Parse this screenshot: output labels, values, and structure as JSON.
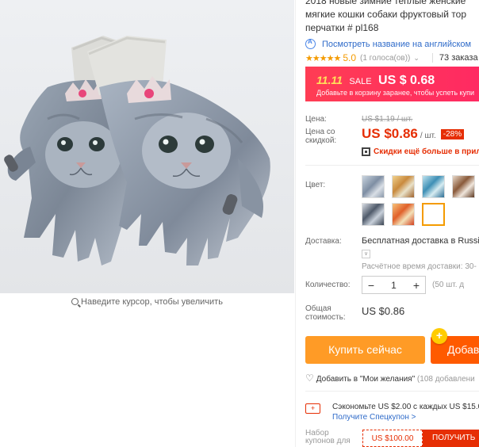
{
  "product": {
    "title_lines": [
      "2018 новые зимние теплые женские",
      "мягкие кошки собаки фруктовый тор",
      "перчатки # pl168"
    ],
    "translate_link": "Посмотреть название на английском",
    "rating_stars": "★★★★★",
    "rating_value": "5.0",
    "votes": "(1 голоса(ов))",
    "orders": "73 заказа"
  },
  "image": {
    "zoom_hint": "Наведите курсор, чтобы увеличить"
  },
  "sale_banner": {
    "date": "11.11",
    "sale": "SALE",
    "amount": "US $ 0.68",
    "note": "Добавьте в корзину заранее, чтобы успеть купи"
  },
  "price": {
    "label": "Цена:",
    "old": "US $1.19 / шт.",
    "discount_label": "Цена со скидкой:",
    "new": "US $0.86",
    "per_unit": "/ шт.",
    "discount_badge": "-28%",
    "promo": "Скидки ещё больше в прило"
  },
  "color": {
    "label": "Цвет:",
    "selected_index": 6
  },
  "shipping": {
    "label": "Доставка:",
    "value": "Бесплатная доставка в Russia",
    "chevron": "∨",
    "time": "Расчётное время доставки: 30-"
  },
  "quantity": {
    "label": "Количество:",
    "minus": "−",
    "value": "1",
    "plus": "+",
    "available": "(50 шт. д"
  },
  "total": {
    "label": "Общая стоимость:",
    "value": "US $0.86"
  },
  "buttons": {
    "buy": "Купить сейчас",
    "cart": "Добав",
    "cart_plus": "+"
  },
  "wishlist": {
    "heart": "♡",
    "text": "Добавить в \"Мои желания\"",
    "count": "(108 добавлени"
  },
  "coupon": {
    "icon": "+",
    "text": "Сэкономьте US $2.00 с каждых US $15.0",
    "link": "Получите Спецкупон >"
  },
  "kit": {
    "label": "Набор купонов для",
    "amount": "US $100.00",
    "get": "ПОЛУЧИТЬ"
  },
  "colors": {
    "sale_red": "#ff3d54",
    "price_red": "#e62e04",
    "buy_orange": "#ff9b26",
    "cart_orange": "#ff5a00",
    "star": "#f49b00",
    "link_blue": "#2f6bc9"
  }
}
